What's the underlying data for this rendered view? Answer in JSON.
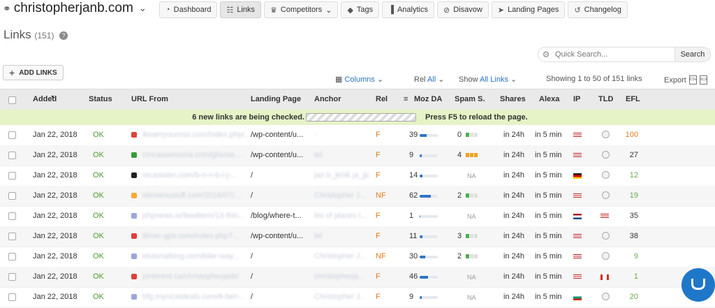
{
  "header": {
    "site": "christopherjanb.com",
    "nav": [
      {
        "icon": "dashboard-icon",
        "label": "Dashboard"
      },
      {
        "icon": "link-icon",
        "label": "Links",
        "active": true
      },
      {
        "icon": "trophy-icon",
        "label": "Competitors",
        "dropdown": true
      },
      {
        "icon": "tag-icon",
        "label": "Tags"
      },
      {
        "icon": "bar-chart-icon",
        "label": "Analytics"
      },
      {
        "icon": "ban-icon",
        "label": "Disavow"
      },
      {
        "icon": "paper-plane-icon",
        "label": "Landing Pages"
      },
      {
        "icon": "history-icon",
        "label": "Changelog"
      }
    ]
  },
  "page": {
    "title": "Links",
    "count": "(151)"
  },
  "search": {
    "placeholder": "Quick Search...",
    "button": "Search"
  },
  "toolbar": {
    "add_links": "ADD LINKS",
    "columns": "Columns",
    "rel_prefix": "Rel",
    "rel_value": "All",
    "show_prefix": "Show",
    "show_value": "All Links",
    "showing": "Showing 1 to 50 of 151 links",
    "export": "Export"
  },
  "columns": [
    "Added",
    "Status",
    "URL From",
    "Landing Page",
    "Anchor",
    "Rel",
    "Moz DA",
    "Spam S.",
    "Shares",
    "Alexa",
    "IP",
    "TLD",
    "EFL"
  ],
  "notice": {
    "left": "6 new links are being checked.",
    "right": "Press F5 to reload the page."
  },
  "colors": {
    "ok": "#4a9b2f",
    "accent": "#2a72c9",
    "rel": "#e47a1a",
    "notice_bg": "#e5f3c7"
  },
  "rows": [
    {
      "added": "Jan 22, 2018",
      "status": "OK",
      "url": "ikeamyoureso.com/index.php/...",
      "landing": "/wp-content/u...",
      "anchor": "-",
      "rel": "F",
      "da": "39",
      "da_pct": 0.39,
      "spam": "0",
      "spam_level": 1,
      "shares": "in 24h",
      "alexa": "in 5 min",
      "ip": "us",
      "efl": "100",
      "fav": "#e0413a"
    },
    {
      "added": "Jan 22, 2018",
      "status": "OK",
      "url": "cincassessoria.com/ghoste...",
      "landing": "/wp-content/u...",
      "anchor": "tel",
      "rel": "F",
      "da": "9",
      "da_pct": 0.12,
      "spam": "4",
      "spam_level": 3,
      "shares": "in 24h",
      "alexa": "in 5 min",
      "ip": "us",
      "efl": "27",
      "fav": "#3a9b3a"
    },
    {
      "added": "Jan 22, 2018",
      "status": "OK",
      "url": "recastabn.com/b-n-n-b-i-j-...",
      "landing": "/",
      "anchor": "jan b_jkhik ja_jp",
      "rel": "F",
      "da": "14",
      "da_pct": 0.16,
      "spam": "NA",
      "spam_level": 0,
      "shares": "in 24h",
      "alexa": "in 5 min",
      "ip": "de",
      "efl": "12",
      "fav": "#222222"
    },
    {
      "added": "Jan 22, 2018",
      "status": "OK",
      "url": "olestencstuff.com/2018/07/...",
      "landing": "/",
      "anchor": "Christopher J...",
      "rel": "NF",
      "da": "62",
      "da_pct": 0.62,
      "spam": "2",
      "spam_level": 1,
      "shares": "in 24h",
      "alexa": "in 5 min",
      "ip": "us",
      "efl": "19",
      "fav": "#f4a93b"
    },
    {
      "added": "Jan 22, 2018",
      "status": "OK",
      "url": "phpnews.io/feeditem/13-thin...",
      "landing": "/blog/where-t...",
      "anchor": "list of places t...",
      "rel": "F",
      "da": "1",
      "da_pct": 0.04,
      "spam": "NA",
      "spam_level": 0,
      "shares": "in 24h",
      "alexa": "in 5 min",
      "ip": "nl",
      "efl": "35",
      "fav": "#9aa7d6"
    },
    {
      "added": "Jan 22, 2018",
      "status": "OK",
      "url": "tilmer-gps.com/index.php?...",
      "landing": "/wp-content/u...",
      "anchor": "tel",
      "rel": "F",
      "da": "11",
      "da_pct": 0.14,
      "spam": "3",
      "spam_level": 1,
      "shares": "in 24h",
      "alexa": "in 5 min",
      "ip": "us",
      "efl": "38",
      "fav": "#e0413a"
    },
    {
      "added": "Jan 22, 2018",
      "status": "OK",
      "url": "etutorialblog.com/kiler-way...",
      "landing": "/",
      "anchor": "Christopher J...",
      "rel": "NF",
      "da": "30",
      "da_pct": 0.32,
      "spam": "2",
      "spam_level": 1,
      "shares": "in 24h",
      "alexa": "in 5 min",
      "ip": "us",
      "efl": "9",
      "fav": "#9aa7d6"
    },
    {
      "added": "Jan 22, 2018",
      "status": "OK",
      "url": "pinterest.ca/christopherjanb/",
      "landing": "/",
      "anchor": "christopherja...",
      "rel": "F",
      "da": "46",
      "da_pct": 0.46,
      "spam": "NA",
      "spam_level": 0,
      "shares": "in 24h",
      "alexa": "in 5 min",
      "ip": "us",
      "efl": "1",
      "fav": "#e0413a"
    },
    {
      "added": "Jan 22, 2018",
      "status": "OK",
      "url": "bfg.myniceideals.com/8-ben...",
      "landing": "/",
      "anchor": "Christopher J...",
      "rel": "F",
      "da": "9",
      "da_pct": 0.12,
      "spam": "NA",
      "spam_level": 0,
      "shares": "in 24h",
      "alexa": "in 5 min",
      "ip": "bg",
      "efl": "20",
      "fav": "#9aa7d6"
    }
  ]
}
